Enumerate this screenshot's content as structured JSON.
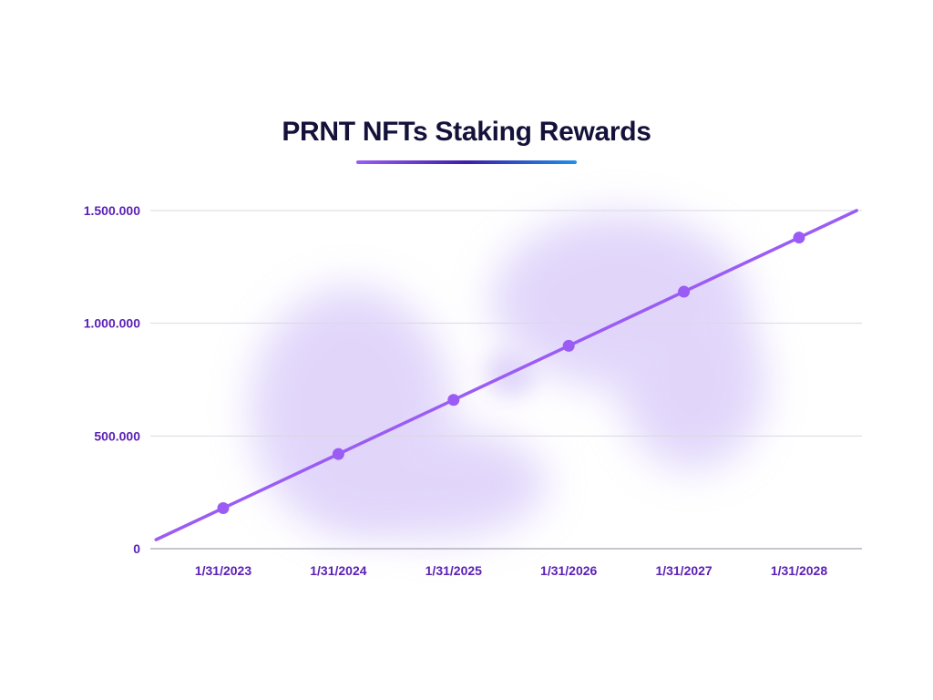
{
  "title": "PRNT NFTs Staking Rewards",
  "colors": {
    "title": "#14123a",
    "accent": "#9a5cf5",
    "tick_label": "#5b21b6",
    "grid": "#d9d9e3",
    "axis": "#8e8ea0",
    "underline_start": "#9a5cf5",
    "underline_mid": "#3b1fa8",
    "underline_end": "#1f8fe8",
    "blob": "#c9b6f7"
  },
  "chart_data": {
    "type": "line",
    "title": "PRNT NFTs Staking Rewards",
    "xlabel": "",
    "ylabel": "",
    "categories": [
      "1/31/2023",
      "1/31/2024",
      "1/31/2025",
      "1/31/2026",
      "1/31/2027",
      "1/31/2028"
    ],
    "series": [
      {
        "values": [
          180000,
          420000,
          660000,
          900000,
          1140000,
          1380000
        ]
      }
    ],
    "line_start_value": 40000,
    "line_end_value": 1500000,
    "ylim": [
      0,
      1500000
    ],
    "yticks": [
      0,
      500000,
      1000000,
      1500000
    ],
    "ytick_labels": [
      "0",
      "500.000",
      "1.000.000",
      "1.500.000"
    ],
    "grid": true,
    "legend": "none"
  }
}
